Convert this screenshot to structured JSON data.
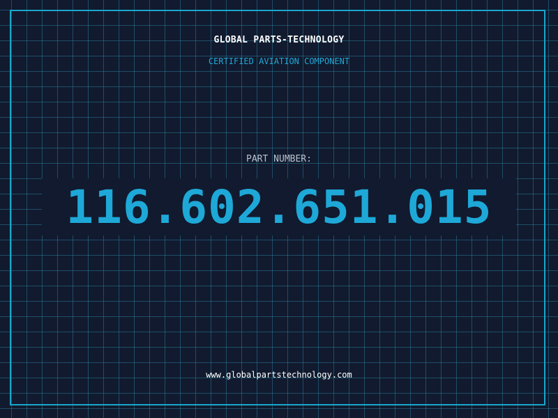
{
  "header": {
    "company": "GLOBAL PARTS-TECHNOLOGY",
    "subtitle": "CERTIFIED AVIATION COMPONENT"
  },
  "part": {
    "label": "PART NUMBER:",
    "number": "116.602.651.015"
  },
  "footer": {
    "website": "www.globalpartstechnology.com"
  },
  "colors": {
    "background": "#111a2e",
    "grid": "#28788f",
    "frame": "#1aa6cc",
    "accent": "#1ea8d8",
    "label": "#b9c2cf"
  }
}
